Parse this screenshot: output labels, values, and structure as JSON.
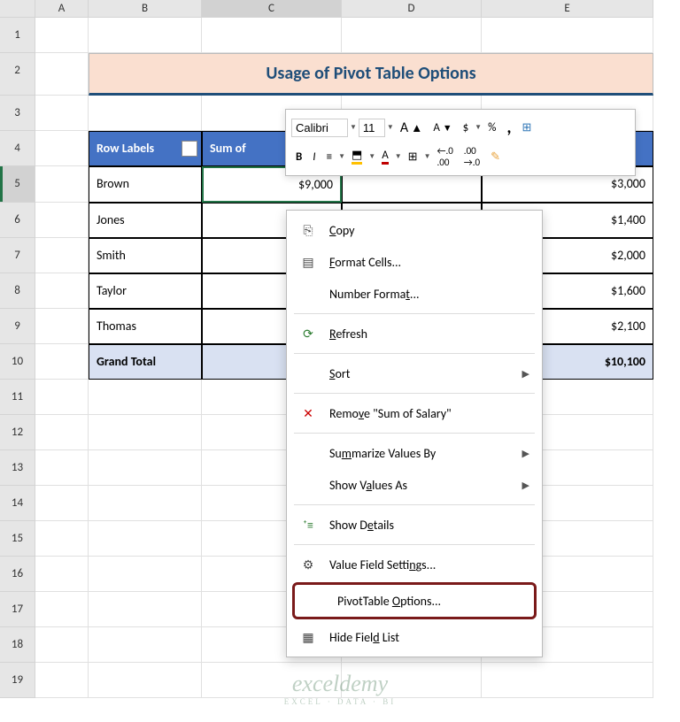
{
  "columns": [
    "",
    "A",
    "B",
    "C",
    "D",
    "E"
  ],
  "rows": [
    "1",
    "2",
    "3",
    "4",
    "5",
    "6",
    "7",
    "8",
    "9",
    "10",
    "11",
    "12",
    "13",
    "14",
    "15",
    "16",
    "17",
    "18",
    "19"
  ],
  "title": "Usage of Pivot Table Options",
  "headers": {
    "row_labels": "Row Labels",
    "sum_of": "Sum of"
  },
  "data": {
    "brown": {
      "name": "Brown",
      "salary": "$9,000",
      "val": "$3,000"
    },
    "jones": {
      "name": "Jones",
      "val": "$1,400"
    },
    "smith": {
      "name": "Smith",
      "val": "$2,000"
    },
    "taylor": {
      "name": "Taylor",
      "val": "$1,600"
    },
    "thomas": {
      "name": "Thomas",
      "val": "$2,100"
    },
    "grand_total": {
      "name": "Grand Total",
      "symbol": "$",
      "val": "$10,100"
    }
  },
  "mini_toolbar": {
    "font": "Calibri",
    "size": "11",
    "bold": "B",
    "italic": "I",
    "percent": "%",
    "dollar": "$",
    "comma": ",",
    "inc_dec": ".00",
    "dec_dec": ".0"
  },
  "context_menu": {
    "copy": "Copy",
    "format_cells": "Format Cells...",
    "number_format": "Number Format...",
    "refresh": "Refresh",
    "sort": "Sort",
    "remove": "Remove \"Sum of Salary\"",
    "summarize": "Summarize Values By",
    "show_values": "Show Values As",
    "show_details": "Show Details",
    "value_field": "Value Field Settings...",
    "pivot_options": "PivotTable Options...",
    "hide_field": "Hide Field List"
  },
  "watermark": {
    "line1": "exceldemy",
    "line2": "EXCEL · DATA · BI"
  }
}
